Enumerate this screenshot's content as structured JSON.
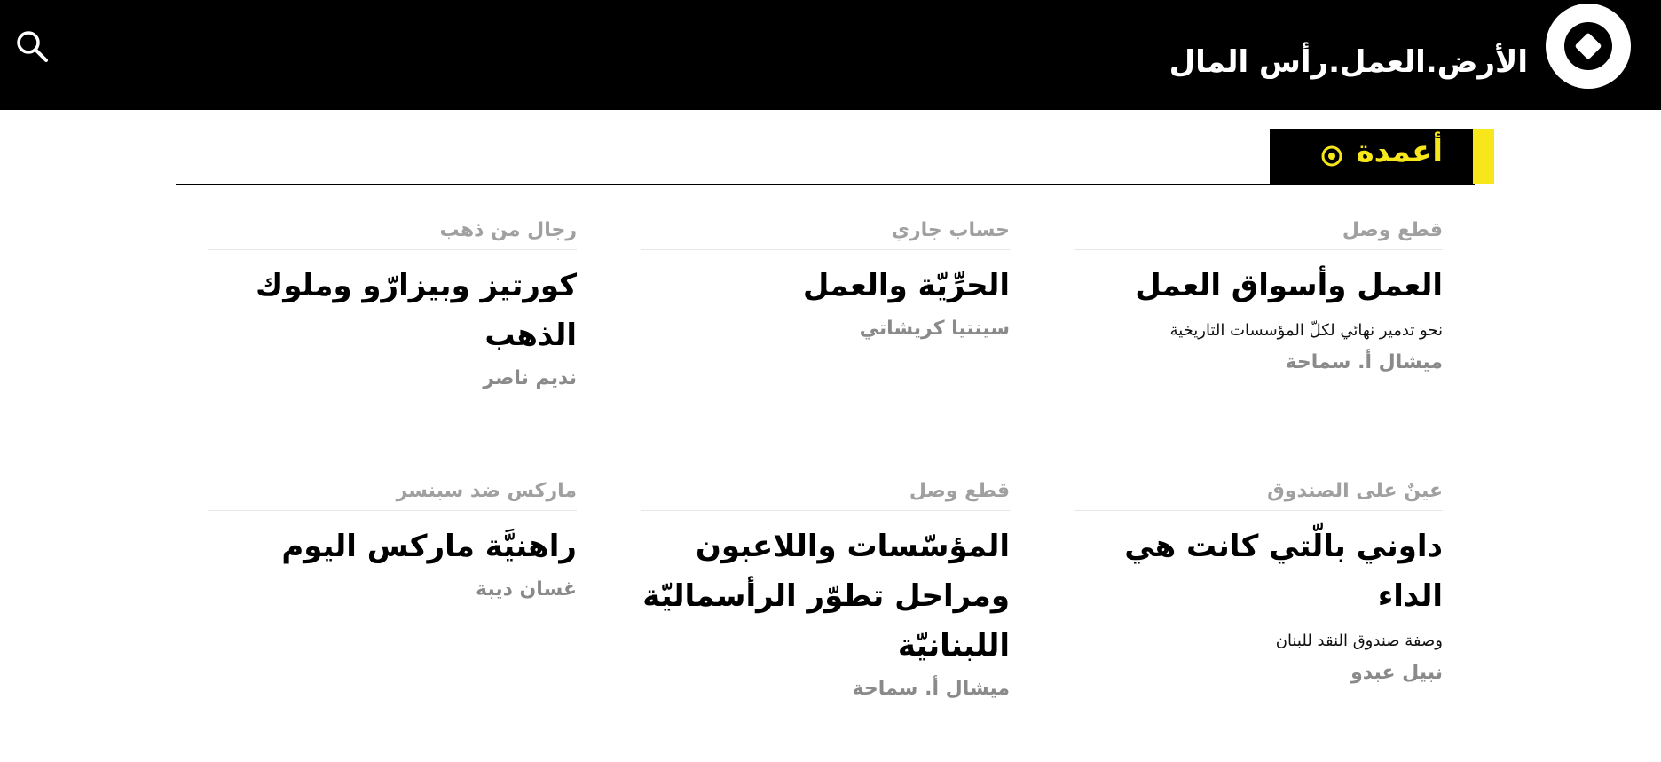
{
  "header": {
    "site_title": "الأرض.العمل.رأس المال",
    "logo_icon": "diamond-circle-logo-icon",
    "search_icon": "search-icon"
  },
  "section": {
    "label": "أعمدة",
    "accent_color": "#f7e71a"
  },
  "articles": [
    {
      "kicker": "قطع وصل",
      "title": "العمل وأسواق العمل",
      "subtitle": "نحو تدمير نهائي لكلّ المؤسسات التاريخية",
      "author": "ميشال أ. سماحة"
    },
    {
      "kicker": "حساب جاري",
      "title": "الحرِّيّة والعمل",
      "subtitle": "",
      "author": "سينتيا كريشاتي"
    },
    {
      "kicker": "رجال من ذهب",
      "title": "كورتيز وبيزارّو وملوك الذهب",
      "subtitle": "",
      "author": "نديم ناصر"
    },
    {
      "kicker": "عينٌ على الصندوق",
      "title": "داوني بالّتي كانت هي الداء",
      "subtitle": "وصفة صندوق النقد للبنان",
      "author": "نبيل عبدو"
    },
    {
      "kicker": "قطع وصل",
      "title": "المؤسّسات واللاعبون ومراحل تطوّر الرأسماليّة اللبنانيّة",
      "subtitle": "",
      "author": "ميشال أ. سماحة"
    },
    {
      "kicker": "ماركس ضد سبنسر",
      "title": "راهنيَّة ماركس اليوم",
      "subtitle": "",
      "author": "غسان ديبة"
    }
  ]
}
